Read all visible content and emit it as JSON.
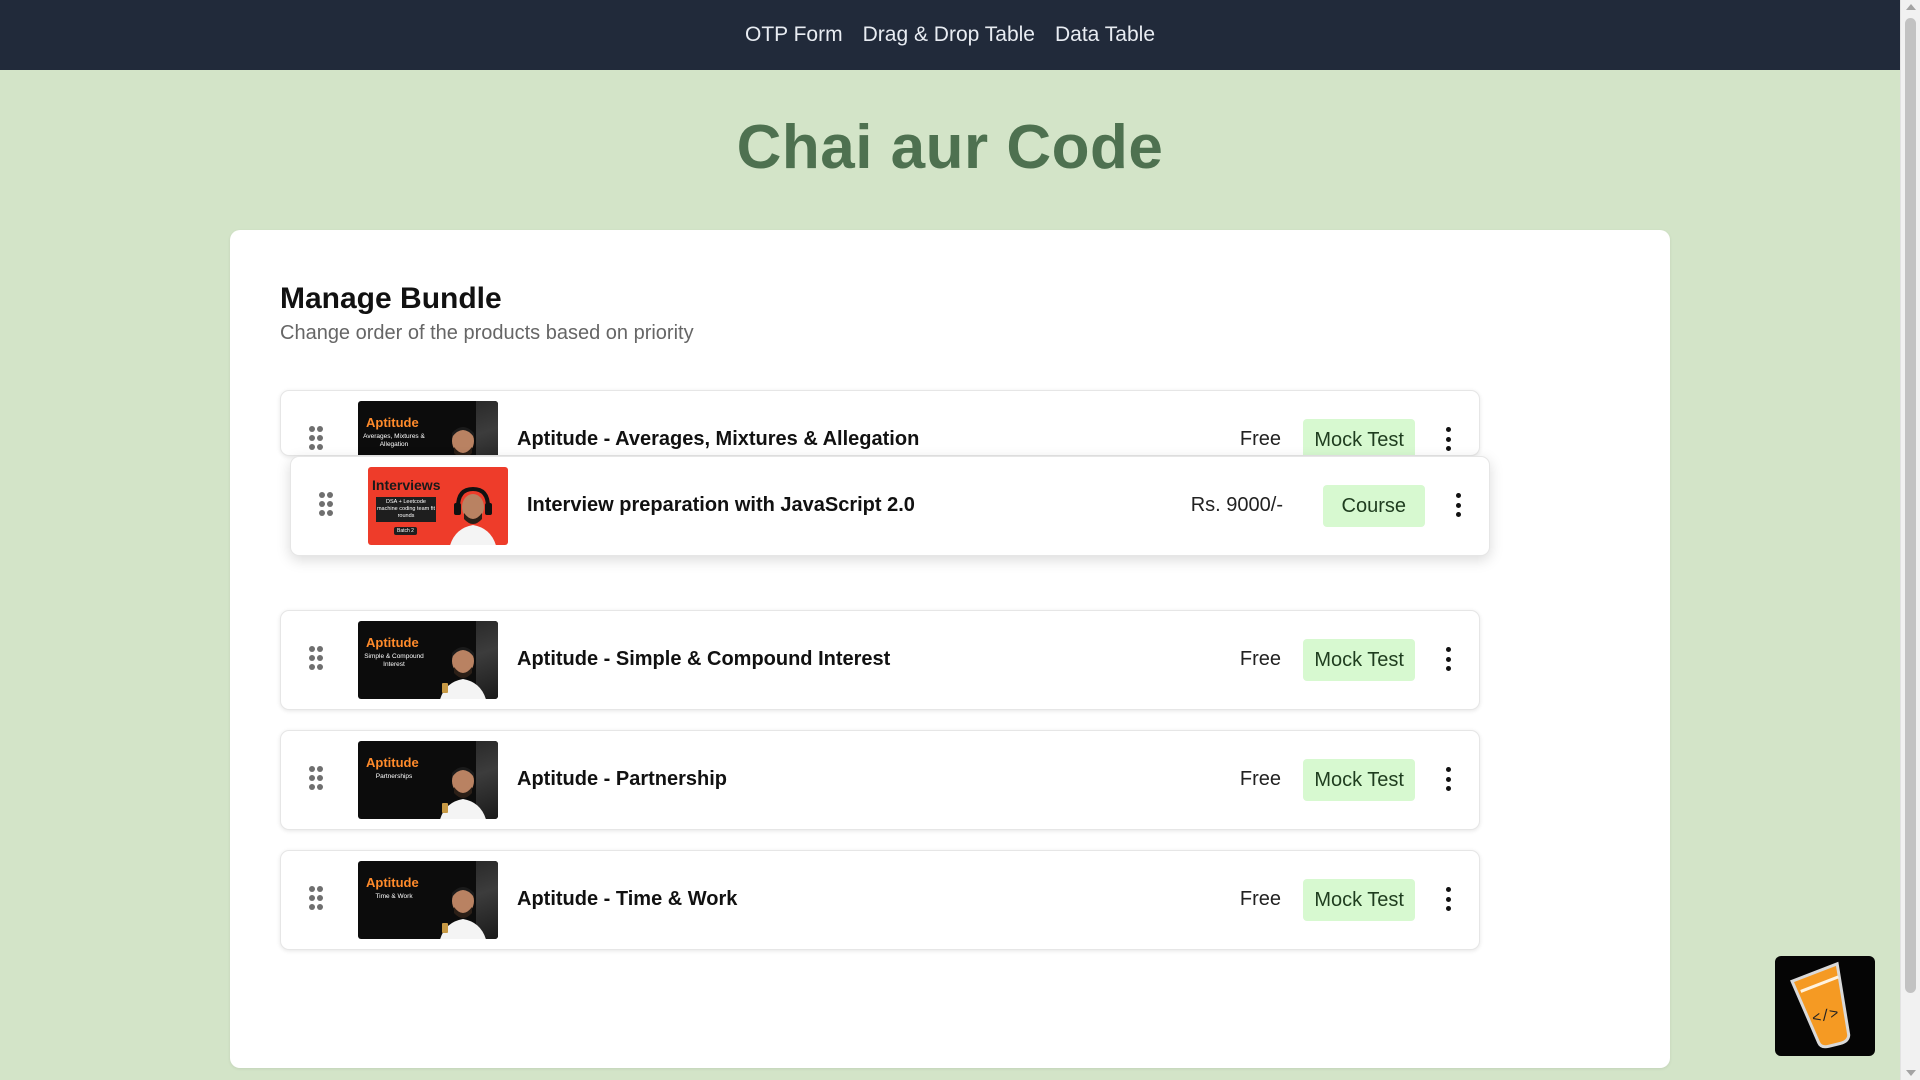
{
  "nav": {
    "links": [
      {
        "label": "OTP Form"
      },
      {
        "label": "Drag & Drop Table"
      },
      {
        "label": "Data Table"
      }
    ]
  },
  "brand": {
    "title": "Chai aur Code"
  },
  "bundle": {
    "title": "Manage Bundle",
    "subtitle": "Change order of the products based on priority",
    "items": [
      {
        "title": "Aptitude - Averages, Mixtures & Allegation",
        "price": "Free",
        "type": "Mock Test",
        "thumb_title": "Aptitude",
        "thumb_sub": "Averages, Mixtures & Allegation"
      },
      {
        "title": "Interview preparation with JavaScript 2.0",
        "price": "Rs. 9000/-",
        "type": "Course",
        "thumb_title": "Interviews",
        "thumb_sub": "DSA + Leetcode machine coding team fit rounds",
        "thumb_batch": "Batch 2",
        "state": "dragging"
      },
      {
        "title": "Aptitude - Simple & Compound Interest",
        "price": "Free",
        "type": "Mock Test",
        "thumb_title": "Aptitude",
        "thumb_sub": "Simple & Compound Interest"
      },
      {
        "title": "Aptitude - Partnership",
        "price": "Free",
        "type": "Mock Test",
        "thumb_title": "Aptitude",
        "thumb_sub": "Partnerships"
      },
      {
        "title": "Aptitude - Time & Work",
        "price": "Free",
        "type": "Mock Test",
        "thumb_title": "Aptitude",
        "thumb_sub": "Time & Work"
      }
    ]
  },
  "fab": {
    "icon": "chai-code-cup-icon"
  },
  "colors": {
    "nav_bg": "#212a3a",
    "page_bg": "#d3e4c8",
    "brand": "#4e7150",
    "badge_bg": "#d7f9d0",
    "thumb_accent": "#ff8b2b"
  }
}
